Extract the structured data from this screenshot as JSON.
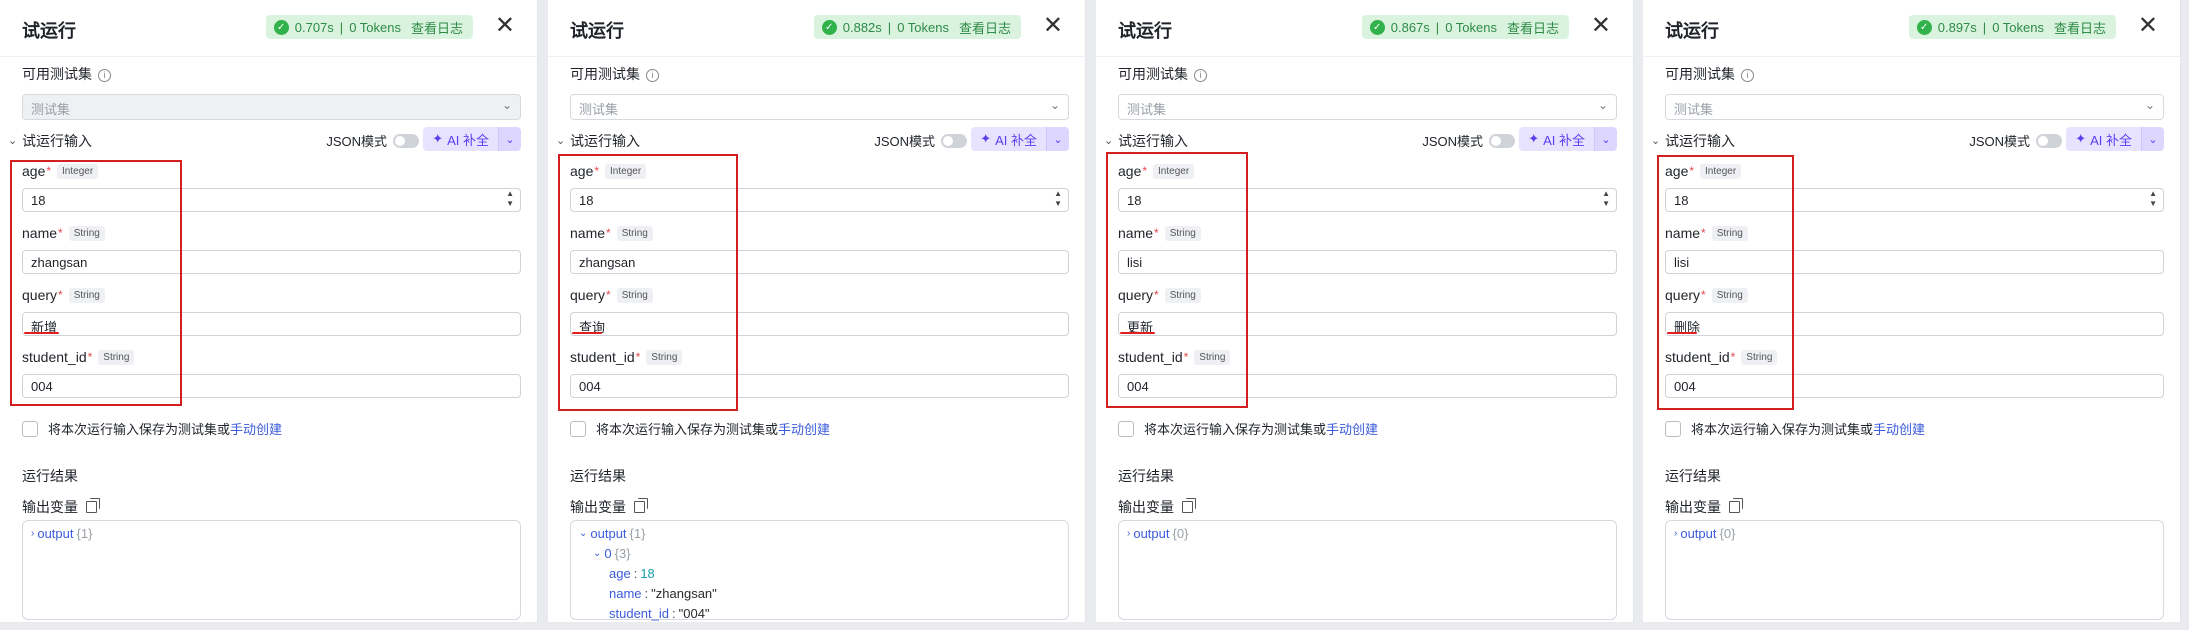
{
  "panels": [
    {
      "title": "试运行",
      "status": {
        "time": "0.707s",
        "tokens": "0 Tokens",
        "log_label": "查看日志"
      },
      "test_set_label": "可用测试集",
      "test_set_placeholder": "测试集",
      "run_input_label": "试运行输入",
      "json_mode_label": "JSON模式",
      "ai_fill_label": "AI 补全",
      "fields": [
        {
          "name": "age",
          "type": "Integer",
          "value": "18"
        },
        {
          "name": "name",
          "type": "String",
          "value": "zhangsan"
        },
        {
          "name": "query",
          "type": "String",
          "value": "新增"
        },
        {
          "name": "student_id",
          "type": "String",
          "value": "004"
        }
      ],
      "save_text": "将本次运行输入保存为测试集或",
      "save_link": "手动创建",
      "result_label": "运行结果",
      "output_label": "输出变量",
      "output": {
        "key": "output",
        "count": "{1}"
      }
    },
    {
      "title": "试运行",
      "status": {
        "time": "0.882s",
        "tokens": "0 Tokens",
        "log_label": "查看日志"
      },
      "test_set_label": "可用测试集",
      "test_set_placeholder": "测试集",
      "run_input_label": "试运行输入",
      "json_mode_label": "JSON模式",
      "ai_fill_label": "AI 补全",
      "fields": [
        {
          "name": "age",
          "type": "Integer",
          "value": "18"
        },
        {
          "name": "name",
          "type": "String",
          "value": "zhangsan"
        },
        {
          "name": "query",
          "type": "String",
          "value": "查询"
        },
        {
          "name": "student_id",
          "type": "String",
          "value": "004"
        }
      ],
      "save_text": "将本次运行输入保存为测试集或",
      "save_link": "手动创建",
      "result_label": "运行结果",
      "output_label": "输出变量",
      "output": {
        "key": "output",
        "count": "{1}",
        "child": {
          "key": "0",
          "count": "{3}"
        },
        "props": [
          {
            "key": "age",
            "value": "18"
          },
          {
            "key": "name",
            "value": "\"zhangsan\""
          },
          {
            "key": "student_id",
            "value": "\"004\""
          }
        ]
      }
    },
    {
      "title": "试运行",
      "status": {
        "time": "0.867s",
        "tokens": "0 Tokens",
        "log_label": "查看日志"
      },
      "test_set_label": "可用测试集",
      "test_set_placeholder": "测试集",
      "run_input_label": "试运行输入",
      "json_mode_label": "JSON模式",
      "ai_fill_label": "AI 补全",
      "fields": [
        {
          "name": "age",
          "type": "Integer",
          "value": "18"
        },
        {
          "name": "name",
          "type": "String",
          "value": "lisi"
        },
        {
          "name": "query",
          "type": "String",
          "value": "更新"
        },
        {
          "name": "student_id",
          "type": "String",
          "value": "004"
        }
      ],
      "save_text": "将本次运行输入保存为测试集或",
      "save_link": "手动创建",
      "result_label": "运行结果",
      "output_label": "输出变量",
      "output": {
        "key": "output",
        "count": "{0}"
      }
    },
    {
      "title": "试运行",
      "status": {
        "time": "0.897s",
        "tokens": "0 Tokens",
        "log_label": "查看日志"
      },
      "test_set_label": "可用测试集",
      "test_set_placeholder": "测试集",
      "run_input_label": "试运行输入",
      "json_mode_label": "JSON模式",
      "ai_fill_label": "AI 补全",
      "fields": [
        {
          "name": "age",
          "type": "Integer",
          "value": "18"
        },
        {
          "name": "name",
          "type": "String",
          "value": "lisi"
        },
        {
          "name": "query",
          "type": "String",
          "value": "删除"
        },
        {
          "name": "student_id",
          "type": "String",
          "value": "004"
        }
      ],
      "save_text": "将本次运行输入保存为测试集或",
      "save_link": "手动创建",
      "result_label": "运行结果",
      "output_label": "输出变量",
      "output": {
        "key": "output",
        "count": "{0}"
      }
    }
  ]
}
